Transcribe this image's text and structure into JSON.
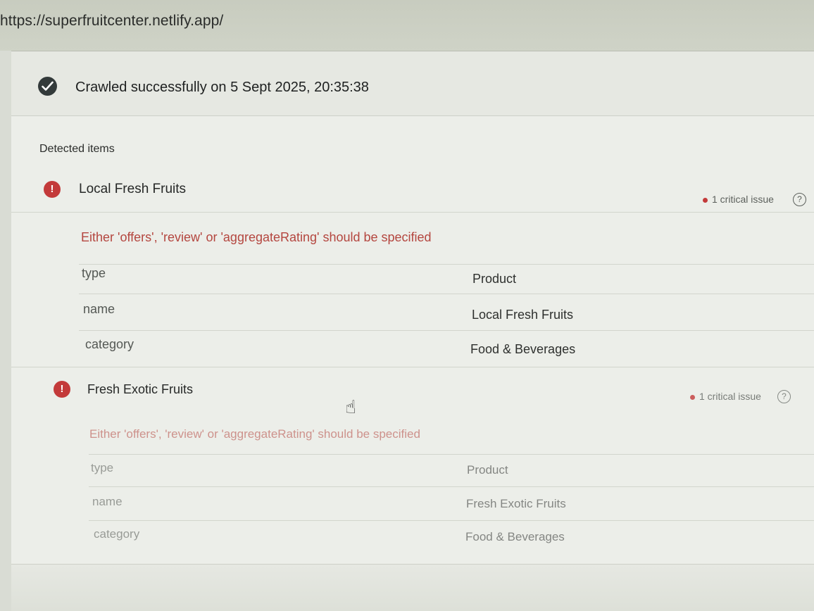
{
  "browser": {
    "url": "https://superfruitcenter.netlify.app/"
  },
  "crawl": {
    "status_text": "Crawled successfully on 5 Sept 2025, 20:35:38"
  },
  "detected": {
    "label": "Detected items",
    "items": [
      {
        "title": "Local Fresh Fruits",
        "issue_text": "1 critical issue",
        "warning": "Either 'offers', 'review' or 'aggregateRating' should be specified",
        "props": [
          {
            "key": "type",
            "value": "Product"
          },
          {
            "key": "name",
            "value": "Local Fresh Fruits"
          },
          {
            "key": "category",
            "value": "Food & Beverages"
          }
        ]
      },
      {
        "title": "Fresh Exotic Fruits",
        "issue_text": "1 critical issue",
        "warning": "Either 'offers', 'review' or 'aggregateRating' should be specified",
        "props": [
          {
            "key": "type",
            "value": "Product"
          },
          {
            "key": "name",
            "value": "Fresh Exotic Fruits"
          },
          {
            "key": "category",
            "value": "Food & Beverages"
          }
        ]
      }
    ]
  },
  "icons": {
    "check": "check-circle-icon",
    "error": "error-circle-icon",
    "help": "help-circle-icon",
    "cursor": "hand-pointer-icon"
  },
  "colors": {
    "error": "#c33a3a",
    "success": "#333a3a",
    "warning_text": "#b4463f"
  }
}
